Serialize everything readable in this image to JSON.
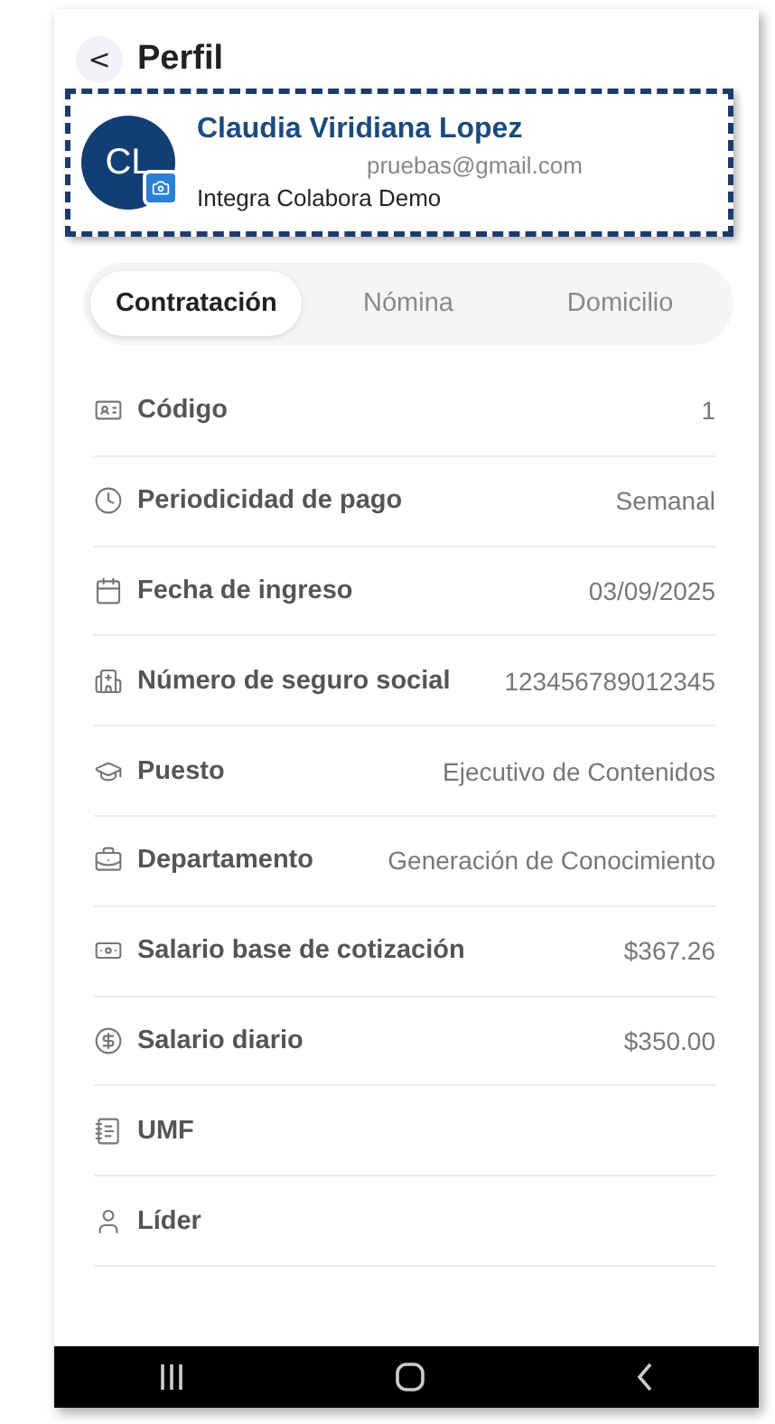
{
  "header": {
    "back": "<",
    "title": "Perfil"
  },
  "profile": {
    "initials": "CL",
    "name": "Claudia Viridiana Lopez",
    "email": "pruebas@gmail.com",
    "company": "Integra Colabora Demo",
    "highlighted": true
  },
  "tabs": [
    {
      "label": "Contratación",
      "selected": true
    },
    {
      "label": "Nómina",
      "selected": false
    },
    {
      "label": "Domicilio",
      "selected": false
    }
  ],
  "fields": [
    {
      "kind": "id",
      "label": "Código",
      "value": "1"
    },
    {
      "kind": "clock",
      "label": "Periodicidad de pago",
      "value": "Semanal"
    },
    {
      "kind": "calendar",
      "label": "Fecha de ingreso",
      "value": "03/09/2025"
    },
    {
      "kind": "hospital",
      "label": "Número de seguro social",
      "value": "123456789012345"
    },
    {
      "kind": "cap",
      "label": "Puesto",
      "value": "Ejecutivo de Contenidos"
    },
    {
      "kind": "briefcase",
      "label": "Departamento",
      "value": "Generación de Conocimiento"
    },
    {
      "kind": "cash",
      "label": "Salario base de cotización",
      "value": "$367.26"
    },
    {
      "kind": "coin",
      "label": "Salario diario",
      "value": "$350.00"
    },
    {
      "kind": "notebook",
      "label": "UMF"
    },
    {
      "kind": "user",
      "label": "Líder"
    }
  ]
}
